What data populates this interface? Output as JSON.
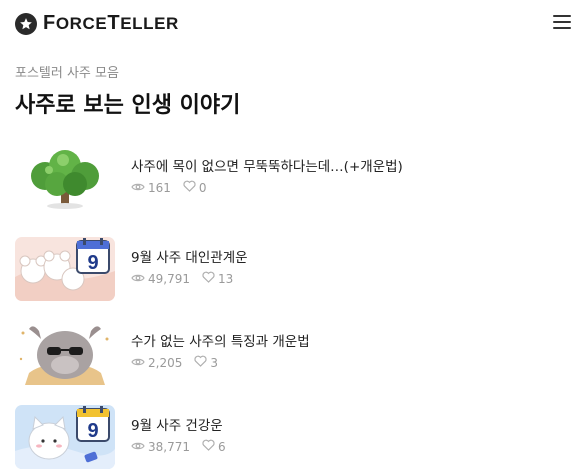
{
  "header": {
    "logo_first": "F",
    "logo_rest_1": "ORCE",
    "logo_mid": "T",
    "logo_rest_2": "ELLER"
  },
  "breadcrumb": "포스텔러 사주 모음",
  "page_title": "사주로 보는 인생 이야기",
  "posts": [
    {
      "title": "사주에 목이 없으면 무뚝뚝하다는데…(+개운법)",
      "views": "161",
      "likes": "0"
    },
    {
      "title": "9월 사주 대인관계운",
      "views": "49,791",
      "likes": "13",
      "badge": "9"
    },
    {
      "title": "수가 없는 사주의 특징과 개운법",
      "views": "2,205",
      "likes": "3"
    },
    {
      "title": "9월 사주 건강운",
      "views": "38,771",
      "likes": "6",
      "badge": "9"
    }
  ],
  "icons": {
    "menu": "hamburger-icon",
    "views": "eye-icon",
    "likes": "heart-icon",
    "logo": "star-icon"
  }
}
